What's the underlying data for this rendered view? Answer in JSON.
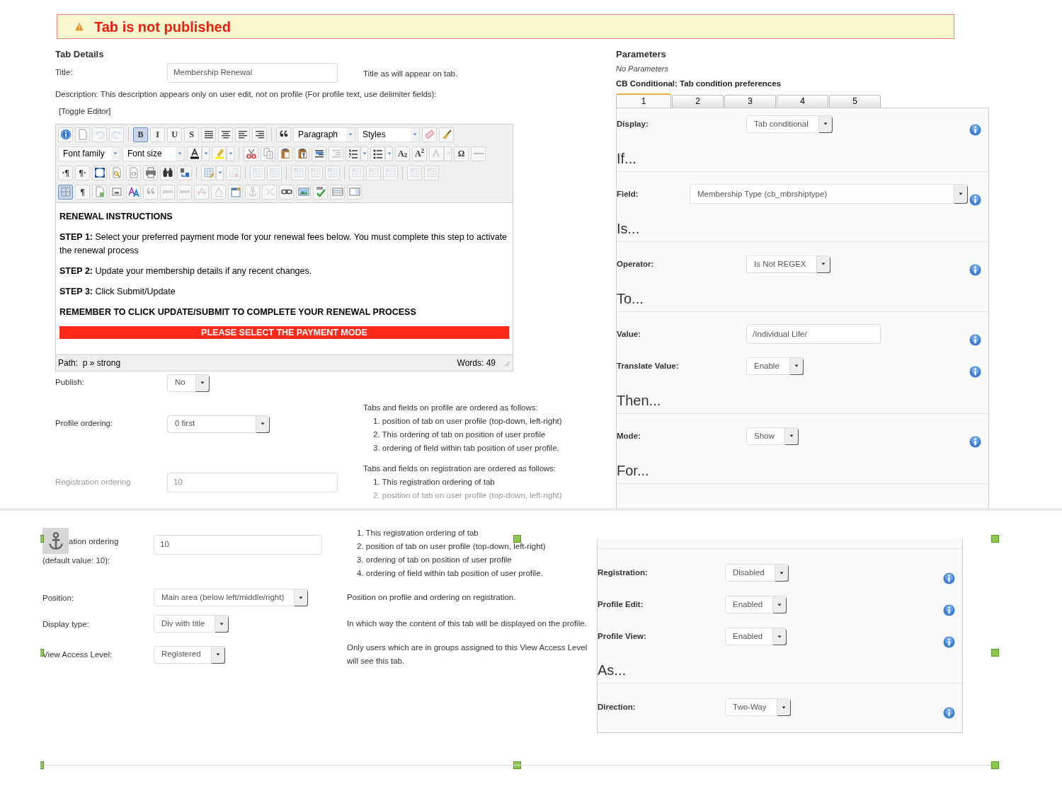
{
  "alert": {
    "text": "Tab is not published"
  },
  "tab_details": {
    "heading": "Tab Details",
    "title": {
      "label": "Title:",
      "value": "Membership Renewal",
      "help": "Title as will appear on tab."
    },
    "description_label": "Description: This description appears only on user edit, not on profile (For profile text, use delimiter fields):",
    "toggle_editor": "[Toggle Editor]",
    "editor": {
      "toolbar": [
        [
          [
            {
              "kind": "icon",
              "on": false,
              "disabled": false
            },
            {
              "kind": "icon",
              "on": false,
              "disabled": false
            },
            {
              "kind": "icon",
              "on": false,
              "disabled": true
            },
            {
              "kind": "icon",
              "on": false,
              "disabled": true
            }
          ],
          [
            {
              "kind": "text",
              "label": "B",
              "on": true,
              "disabled": false
            },
            {
              "kind": "text",
              "label": "I",
              "on": false,
              "disabled": false
            },
            {
              "kind": "text",
              "label": "U",
              "on": false,
              "disabled": false
            },
            {
              "kind": "text",
              "label": "S",
              "on": false,
              "disabled": false
            },
            {
              "kind": "icon",
              "on": false,
              "disabled": false
            },
            {
              "kind": "icon",
              "on": false,
              "disabled": false
            },
            {
              "kind": "icon",
              "on": false,
              "disabled": false
            },
            {
              "kind": "icon",
              "on": false,
              "disabled": false
            }
          ],
          [
            {
              "kind": "icon",
              "on": false,
              "disabled": false
            },
            {
              "kind": "select",
              "label": "Paragraph"
            },
            {
              "kind": "select",
              "label": "Styles"
            },
            {
              "kind": "icon",
              "on": false,
              "disabled": false
            },
            {
              "kind": "icon",
              "on": false,
              "disabled": false
            }
          ]
        ],
        [
          [
            {
              "kind": "select",
              "label": "Font family"
            },
            {
              "kind": "select",
              "label": "Font size"
            },
            {
              "kind": "split",
              "on": false,
              "disabled": false
            },
            {
              "kind": "split",
              "on": false,
              "disabled": false
            }
          ],
          [
            {
              "kind": "icon",
              "on": false,
              "disabled": false
            },
            {
              "kind": "icon",
              "on": false,
              "disabled": false
            },
            {
              "kind": "icon",
              "on": false,
              "disabled": false
            },
            {
              "kind": "icon",
              "on": false,
              "disabled": false
            },
            {
              "kind": "icon",
              "on": false,
              "disabled": false
            },
            {
              "kind": "icon",
              "on": false,
              "disabled": true
            },
            {
              "kind": "split",
              "on": false,
              "disabled": false
            },
            {
              "kind": "split",
              "on": false,
              "disabled": false
            },
            {
              "kind": "text",
              "label": "A$_{2}$",
              "on": false,
              "disabled": false
            },
            {
              "kind": "text",
              "label": "A$^{2}$",
              "on": false,
              "disabled": false
            },
            {
              "kind": "split",
              "on": false,
              "disabled": true
            },
            {
              "kind": "text",
              "label": "Ω",
              "on": false,
              "disabled": false
            },
            {
              "kind": "icon",
              "on": false,
              "disabled": false
            }
          ]
        ],
        [
          [
            {
              "kind": "text",
              "label": "·¶",
              "on": false,
              "disabled": false
            },
            {
              "kind": "text",
              "label": "¶·",
              "on": false,
              "disabled": false
            },
            {
              "kind": "icon",
              "on": false,
              "disabled": false
            },
            {
              "kind": "icon",
              "on": false,
              "disabled": false
            },
            {
              "kind": "icon",
              "on": false,
              "disabled": false
            },
            {
              "kind": "icon",
              "on": false,
              "disabled": false
            },
            {
              "kind": "icon",
              "on": false,
              "disabled": false
            },
            {
              "kind": "icon",
              "on": false,
              "disabled": false
            }
          ],
          [
            {
              "kind": "split",
              "on": false,
              "disabled": false
            },
            {
              "kind": "icon",
              "on": false,
              "disabled": true
            }
          ],
          [
            {
              "kind": "icon",
              "on": false,
              "disabled": true
            },
            {
              "kind": "icon",
              "on": false,
              "disabled": true
            }
          ],
          [
            {
              "kind": "icon",
              "on": false,
              "disabled": true
            },
            {
              "kind": "icon",
              "on": false,
              "disabled": true
            },
            {
              "kind": "icon",
              "on": false,
              "disabled": true
            }
          ],
          [
            {
              "kind": "icon",
              "on": false,
              "disabled": true
            },
            {
              "kind": "icon",
              "on": false,
              "disabled": true
            },
            {
              "kind": "icon",
              "on": false,
              "disabled": true
            }
          ],
          [
            {
              "kind": "icon",
              "on": false,
              "disabled": true
            },
            {
              "kind": "icon",
              "on": false,
              "disabled": true
            }
          ]
        ],
        [
          [
            {
              "kind": "icon",
              "on": true,
              "disabled": false
            },
            {
              "kind": "text",
              "label": "¶",
              "on": false,
              "disabled": false
            },
            {
              "kind": "icon",
              "on": false,
              "disabled": false
            },
            {
              "kind": "icon",
              "on": false,
              "disabled": false
            },
            {
              "kind": "icon",
              "on": false,
              "disabled": false
            },
            {
              "kind": "icon",
              "on": false,
              "disabled": true
            },
            {
              "kind": "icon",
              "on": false,
              "disabled": true
            },
            {
              "kind": "icon",
              "on": false,
              "disabled": true
            },
            {
              "kind": "icon",
              "on": false,
              "disabled": true
            },
            {
              "kind": "icon",
              "on": false,
              "disabled": true
            },
            {
              "kind": "icon",
              "on": false,
              "disabled": false
            },
            {
              "kind": "icon",
              "on": false,
              "disabled": true
            },
            {
              "kind": "icon",
              "on": false,
              "disabled": true
            },
            {
              "kind": "icon",
              "on": false,
              "disabled": false
            },
            {
              "kind": "icon",
              "on": false,
              "disabled": false
            },
            {
              "kind": "icon",
              "on": false,
              "disabled": false
            },
            {
              "kind": "icon",
              "on": false,
              "disabled": false
            },
            {
              "kind": "icon",
              "on": false,
              "disabled": false
            }
          ]
        ]
      ],
      "content": [
        {
          "kind": "heading",
          "text": "RENEWAL INSTRUCTIONS"
        },
        {
          "kind": "paragraph",
          "text": "**STEP 1:** Select your preferred payment mode for your renewal fees below. You must complete this step to activate the renewal process"
        },
        {
          "kind": "paragraph",
          "text": "**STEP 2:**  Update your membership details if any recent changes."
        },
        {
          "kind": "paragraph",
          "text": "**STEP 3:** Click Submit/Update"
        },
        {
          "kind": "heading",
          "text": "REMEMBER TO CLICK UPDATE/SUBMIT TO COMPLETE YOUR RENEWAL PROCESS"
        },
        {
          "kind": "banner",
          "text": "PLEASE SELECT THE PAYMENT MODE"
        }
      ],
      "path": "Path:  p » strong",
      "words": "Words: 49"
    },
    "fields": [
      {
        "kind": "select",
        "label": "Publish:",
        "value": "No"
      },
      {
        "kind": "select",
        "label": "Profile ordering:",
        "value": "0 first"
      },
      {
        "kind": "input",
        "label": "Registration ordering",
        "value": "10"
      }
    ],
    "ordering_help": [
      {
        "intro": "Tabs and fields on profile are ordered as follows:",
        "items": [
          "1. position of tab on user profile (top-down, left-right)",
          "2. This ordering of tab on position of user profile",
          "3. ordering of field within tab position of user profile."
        ]
      },
      {
        "intro": "Tabs and fields on registration are ordered as follows:",
        "items": [
          "1. This registration ordering of tab",
          "2. position of tab on user profile (top-down, left-right)"
        ]
      }
    ]
  },
  "parameters": {
    "heading": "Parameters",
    "note": "No Parameters",
    "subheading": "CB Conditional: Tab condition preferences",
    "tabs": [
      {
        "label": "1",
        "selected": true
      },
      {
        "label": "2",
        "selected": false
      },
      {
        "label": "3",
        "selected": false
      },
      {
        "label": "4",
        "selected": false
      },
      {
        "label": "5",
        "selected": false
      }
    ],
    "rows": [
      {
        "kind": "select",
        "label": "Display:",
        "value": "Tab conditional"
      },
      {
        "kind": "heading",
        "text": "If..."
      },
      {
        "kind": "wide-select",
        "label": "Field:",
        "value": "Membership Type (cb_mbrshiptype)"
      },
      {
        "kind": "heading",
        "text": "Is..."
      },
      {
        "kind": "select",
        "label": "Operator:",
        "value": "Is Not REGEX"
      },
      {
        "kind": "heading",
        "text": "To..."
      },
      {
        "kind": "input",
        "label": "Value:",
        "value": "/Individual Life/"
      },
      {
        "kind": "select",
        "label": "Translate Value:",
        "value": "Enable"
      },
      {
        "kind": "heading",
        "text": "Then..."
      },
      {
        "kind": "select",
        "label": "Mode:",
        "value": "Show"
      },
      {
        "kind": "heading",
        "text": "For..."
      }
    ]
  },
  "lower": {
    "fields": [
      {
        "kind": "input",
        "label": "ation ordering",
        "sublabel": "(default value: 10):",
        "value": "10",
        "help_items": [
          "1. This registration ordering of tab",
          "2. position of tab on user profile (top-down, left-right)",
          "3. ordering of tab on position of user profile",
          "4. ordering of field within tab position of user profile."
        ]
      },
      {
        "kind": "select",
        "label": "Position:",
        "value": "Main area (below left/middle/right)",
        "help": "Position on profile and ordering on registration."
      },
      {
        "kind": "select",
        "label": "Display type:",
        "value": "Div with title",
        "help": "In which way the content of this tab will be displayed on the profile."
      },
      {
        "kind": "select",
        "label": "View Access Level:",
        "value": "Registered",
        "help": "Only users which are in groups assigned to this View Access Level will see this tab."
      }
    ],
    "conditions": [
      {
        "kind": "select",
        "label": "Registration:",
        "value": "Disabled"
      },
      {
        "kind": "select",
        "label": "Profile Edit:",
        "value": "Enabled"
      },
      {
        "kind": "select",
        "label": "Profile View:",
        "value": "Enabled"
      },
      {
        "kind": "heading",
        "text": "As..."
      },
      {
        "kind": "select",
        "label": "Direction:",
        "value": "Two-Way"
      }
    ]
  }
}
